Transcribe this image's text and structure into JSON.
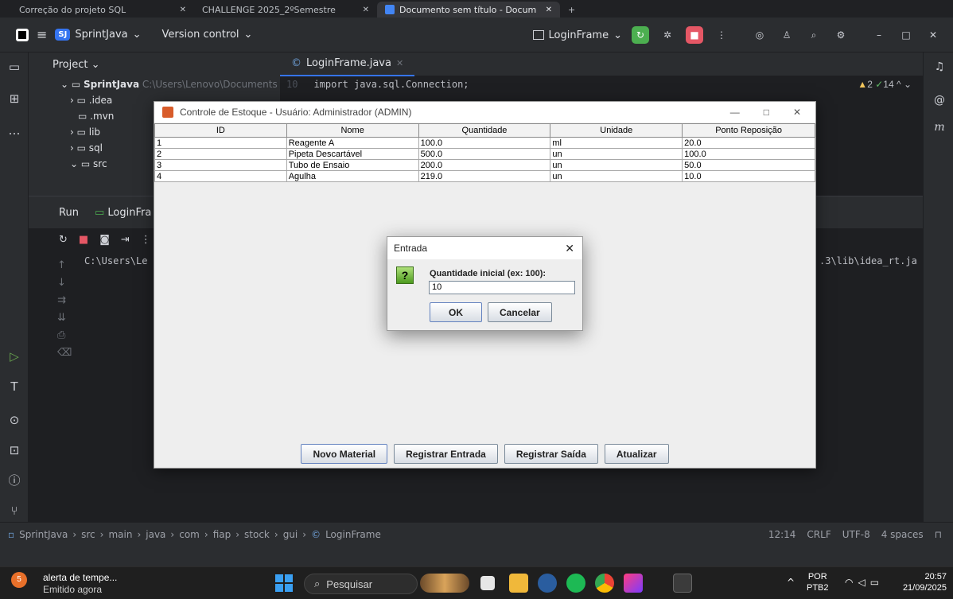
{
  "browser": {
    "tabs": [
      {
        "label": "Correção do projeto SQL"
      },
      {
        "label": "CHALLENGE 2025_2ºSemestre"
      },
      {
        "label": "Documento sem título - Docum"
      }
    ]
  },
  "ide": {
    "project_badge": "SJ",
    "project_name": "SprintJava",
    "vcs": "Version control",
    "run_config": "LoginFrame",
    "project_panel": {
      "title": "Project",
      "root": "SprintJava",
      "root_path": "C:\\Users\\Lenovo\\Documents",
      "items": [
        ".idea",
        ".mvn",
        "lib",
        "sql",
        "src"
      ]
    },
    "editor": {
      "tab": "LoginFrame.java",
      "line_number": "10",
      "code_line": "import java.sql.Connection;",
      "warnings": "2",
      "checks": "14",
      "italic_marker": "m"
    },
    "run_panel": {
      "label": "Run",
      "config": "LoginFra",
      "console_left": "C:\\Users\\Le",
      "console_right": ".3\\lib\\idea_rt.ja"
    },
    "status_bar": {
      "breadcrumb": [
        "SprintJava",
        "src",
        "main",
        "java",
        "com",
        "fiap",
        "stock",
        "gui",
        "LoginFrame"
      ],
      "position": "12:14",
      "line_sep": "CRLF",
      "encoding": "UTF-8",
      "indent": "4 spaces"
    }
  },
  "app": {
    "title": "Controle de Estoque - Usuário: Administrador (ADMIN)",
    "columns": [
      "ID",
      "Nome",
      "Quantidade",
      "Unidade",
      "Ponto Reposição"
    ],
    "rows": [
      [
        "1",
        "Reagente A",
        "100.0",
        "ml",
        "20.0"
      ],
      [
        "2",
        "Pipeta Descartável",
        "500.0",
        "un",
        "100.0"
      ],
      [
        "3",
        "Tubo de Ensaio",
        "200.0",
        "un",
        "50.0"
      ],
      [
        "4",
        "Agulha",
        "219.0",
        "un",
        "10.0"
      ]
    ],
    "buttons": {
      "novo": "Novo Material",
      "entrada": "Registrar Entrada",
      "saida": "Registrar Saída",
      "atualizar": "Atualizar"
    }
  },
  "dialog": {
    "title": "Entrada",
    "prompt": "Quantidade inicial (ex: 100):",
    "value": "10",
    "ok": "OK",
    "cancel": "Cancelar"
  },
  "taskbar": {
    "notif_count": "5",
    "notif_title": "alerta de tempe...",
    "notif_sub": "Emitido agora",
    "search_placeholder": "Pesquisar",
    "lang": "POR",
    "layout": "PTB2",
    "time": "20:57",
    "date": "21/09/2025"
  }
}
